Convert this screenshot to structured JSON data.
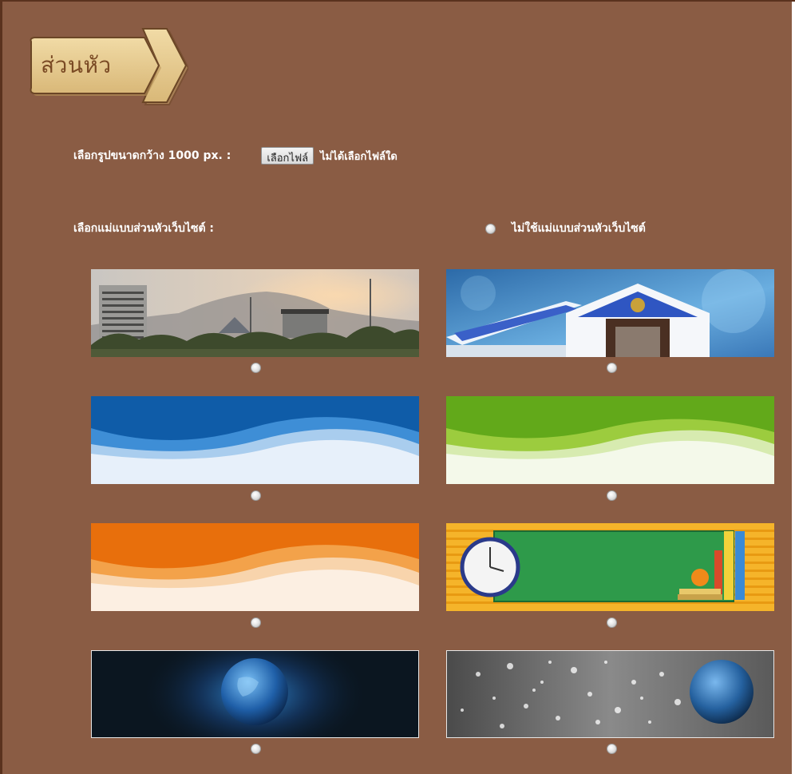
{
  "section": {
    "title": "ส่วนหัว"
  },
  "upload": {
    "label": "เลือกรูปขนาดกว้าง 1000 px. :",
    "button_label": "เลือกไฟล์",
    "status": "ไม่ได้เลือกไฟล์ใด"
  },
  "templates": {
    "label": "เลือกแม่แบบส่วนหัวเว็บไซต์ :",
    "no_template_label": "ไม่ใช้แม่แบบส่วนหัวเว็บไซต์",
    "items": [
      {
        "name": "campus-photo"
      },
      {
        "name": "blue-building"
      },
      {
        "name": "blue-wave"
      },
      {
        "name": "green-wave"
      },
      {
        "name": "orange-wave"
      },
      {
        "name": "chalkboard-clock"
      },
      {
        "name": "dark-globe"
      },
      {
        "name": "silver-bokeh-globe"
      }
    ]
  },
  "colors": {
    "background": "#8a5c44",
    "tag": "#e8cf95",
    "text": "#ffffff"
  }
}
